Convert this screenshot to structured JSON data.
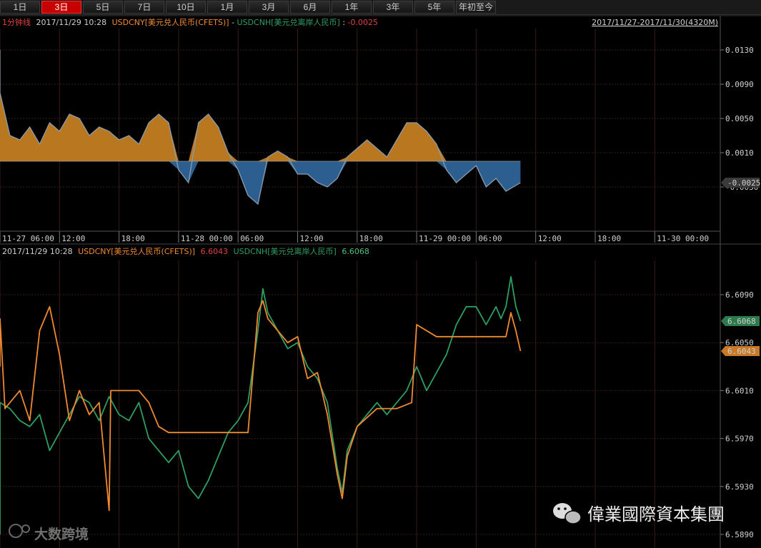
{
  "tabs": [
    {
      "label": "1日",
      "active": false
    },
    {
      "label": "3日",
      "active": true
    },
    {
      "label": "5日",
      "active": false
    },
    {
      "label": "7日",
      "active": false
    },
    {
      "label": "10日",
      "active": false
    },
    {
      "label": "1月",
      "active": false
    },
    {
      "label": "3月",
      "active": false
    },
    {
      "label": "6月",
      "active": false
    },
    {
      "label": "1年",
      "active": false
    },
    {
      "label": "3年",
      "active": false
    },
    {
      "label": "5年",
      "active": false
    },
    {
      "label": "年初至今",
      "active": false
    }
  ],
  "top_panel": {
    "interval": "1分钟线",
    "datetime": "2017/11/29 10:28",
    "series_a": "USDCNY[美元兑人民币(CFETS)]",
    "separator": " - ",
    "series_b": "USDCNH[美元兑离岸人民币]",
    "value_sep": ": ",
    "value": "-0.0025",
    "range": "2017/11/27-2017/11/30(4320M)",
    "current_tag": "-0.0025",
    "y_ticks": [
      "0.0130",
      "0.0090",
      "0.0050",
      "0.0010",
      "-0.0030"
    ],
    "x_ticks": [
      "11-27 06:00",
      "12:00",
      "18:00",
      "11-28 00:00",
      "06:00",
      "12:00",
      "18:00",
      "11-29 00:00",
      "06:00",
      "12:00",
      "18:00",
      "11-30 00:00"
    ]
  },
  "bottom_panel": {
    "datetime": "2017/11/29 10:28",
    "series_a": "USDCNY[美元兑人民币(CFETS)]",
    "value_a": "6.6043",
    "series_b": "USDCNH[美元兑离岸人民币]",
    "value_b": "6.6068",
    "tag_b": "6.6068",
    "tag_a": "6.6043",
    "y_ticks": [
      "6.6090",
      "6.6050",
      "6.6010",
      "6.5970",
      "6.5930",
      "6.5890"
    ]
  },
  "watermark": {
    "left": "大数跨境",
    "right": "偉業國際資本集團"
  },
  "colors": {
    "cny": "#f08a30",
    "cnh": "#2e9e62",
    "spread_pos": "#b9781f",
    "spread_neg": "#2c5f8f",
    "active_tab": "#c80000"
  },
  "chart_data": [
    {
      "type": "area",
      "ylim": [
        -0.0055,
        0.0155
      ],
      "x_start": "2017-11-27 03:00",
      "x_end": "2017-11-30 03:00",
      "series": [
        {
          "name": "USDCNY[美元兑人民币(CFETS)] - USDCNH[美元兑离岸人民币]",
          "points": [
            [
              "2017-11-27 03:00",
              0.013
            ],
            [
              "2017-11-27 04:00",
              0.0125
            ],
            [
              "2017-11-27 05:00",
              0.011
            ],
            [
              "2017-11-27 06:00",
              0.008
            ],
            [
              "2017-11-27 07:00",
              0.003
            ],
            [
              "2017-11-27 08:00",
              0.0025
            ],
            [
              "2017-11-27 09:00",
              0.004
            ],
            [
              "2017-11-27 10:00",
              0.002
            ],
            [
              "2017-11-27 11:00",
              0.0045
            ],
            [
              "2017-11-27 12:00",
              0.0035
            ],
            [
              "2017-11-27 13:00",
              0.0055
            ],
            [
              "2017-11-27 14:00",
              0.005
            ],
            [
              "2017-11-27 15:00",
              0.003
            ],
            [
              "2017-11-27 16:00",
              0.004
            ],
            [
              "2017-11-27 17:00",
              0.0035
            ],
            [
              "2017-11-27 18:00",
              0.0025
            ],
            [
              "2017-11-27 19:00",
              0.003
            ],
            [
              "2017-11-27 20:00",
              0.002
            ],
            [
              "2017-11-27 21:00",
              0.0045
            ],
            [
              "2017-11-27 22:00",
              0.0055
            ],
            [
              "2017-11-27 23:00",
              0.0045
            ],
            [
              "2017-11-28 00:00",
              -0.001
            ],
            [
              "2017-11-28 01:00",
              -0.0025
            ],
            [
              "2017-11-28 02:00",
              0.0045
            ],
            [
              "2017-11-28 03:00",
              0.0055
            ],
            [
              "2017-11-28 04:00",
              0.004
            ],
            [
              "2017-11-28 05:00",
              0.001
            ],
            [
              "2017-11-28 06:00",
              -0.001
            ],
            [
              "2017-11-28 07:00",
              -0.004
            ],
            [
              "2017-11-28 08:00",
              -0.005
            ],
            [
              "2017-11-28 09:00",
              0.0005
            ],
            [
              "2017-11-28 10:00",
              0.0012
            ],
            [
              "2017-11-28 11:00",
              0.0005
            ],
            [
              "2017-11-28 12:00",
              -0.0015
            ],
            [
              "2017-11-28 13:00",
              -0.0015
            ],
            [
              "2017-11-28 14:00",
              -0.0025
            ],
            [
              "2017-11-28 15:00",
              -0.003
            ],
            [
              "2017-11-28 16:00",
              -0.002
            ],
            [
              "2017-11-28 17:00",
              0.0005
            ],
            [
              "2017-11-28 18:00",
              0.0015
            ],
            [
              "2017-11-28 19:00",
              0.0025
            ],
            [
              "2017-11-28 20:00",
              0.0015
            ],
            [
              "2017-11-28 21:00",
              0.0005
            ],
            [
              "2017-11-28 22:00",
              0.0025
            ],
            [
              "2017-11-28 23:00",
              0.0045
            ],
            [
              "2017-11-29 00:00",
              0.0045
            ],
            [
              "2017-11-29 01:00",
              0.0035
            ],
            [
              "2017-11-29 02:00",
              0.002
            ],
            [
              "2017-11-29 03:00",
              -0.001
            ],
            [
              "2017-11-29 04:00",
              -0.0025
            ],
            [
              "2017-11-29 05:00",
              -0.0015
            ],
            [
              "2017-11-29 06:00",
              -0.0005
            ],
            [
              "2017-11-29 07:00",
              -0.003
            ],
            [
              "2017-11-29 08:00",
              -0.002
            ],
            [
              "2017-11-29 09:00",
              -0.0035
            ],
            [
              "2017-11-29 10:28",
              -0.0025
            ]
          ]
        }
      ]
    },
    {
      "type": "line",
      "ylim": [
        6.5885,
        6.612
      ],
      "x_start": "2017-11-27 03:00",
      "x_end": "2017-11-30 03:00",
      "series": [
        {
          "name": "USDCNY[美元兑人民币(CFETS)]",
          "points": [
            [
              "2017-11-27 03:00",
              6.603
            ],
            [
              "2017-11-27 05:00",
              6.603
            ],
            [
              "2017-11-27 05:30",
              6.607
            ],
            [
              "2017-11-27 06:30",
              6.5995
            ],
            [
              "2017-11-27 08:00",
              6.601
            ],
            [
              "2017-11-27 09:00",
              6.5985
            ],
            [
              "2017-11-27 10:00",
              6.606
            ],
            [
              "2017-11-27 11:00",
              6.608
            ],
            [
              "2017-11-27 12:00",
              6.604
            ],
            [
              "2017-11-27 13:00",
              6.5985
            ],
            [
              "2017-11-27 14:00",
              6.601
            ],
            [
              "2017-11-27 15:00",
              6.599
            ],
            [
              "2017-11-27 16:00",
              6.6
            ],
            [
              "2017-11-27 17:00",
              6.591
            ],
            [
              "2017-11-27 17:10",
              6.601
            ],
            [
              "2017-11-27 19:00",
              6.601
            ],
            [
              "2017-11-27 20:00",
              6.601
            ],
            [
              "2017-11-27 21:00",
              6.6
            ],
            [
              "2017-11-27 22:00",
              6.598
            ],
            [
              "2017-11-27 23:00",
              6.5975
            ],
            [
              "2017-11-28 06:00",
              6.5975
            ],
            [
              "2017-11-28 07:00",
              6.5975
            ],
            [
              "2017-11-28 08:00",
              6.6075
            ],
            [
              "2017-11-28 08:30",
              6.6085
            ],
            [
              "2017-11-28 09:00",
              6.607
            ],
            [
              "2017-11-28 10:00",
              6.606
            ],
            [
              "2017-11-28 11:00",
              6.605
            ],
            [
              "2017-11-28 12:00",
              6.6055
            ],
            [
              "2017-11-28 13:00",
              6.602
            ],
            [
              "2017-11-28 14:00",
              6.6025
            ],
            [
              "2017-11-28 15:00",
              6.599
            ],
            [
              "2017-11-28 16:00",
              6.594
            ],
            [
              "2017-11-28 16:30",
              6.592
            ],
            [
              "2017-11-28 17:00",
              6.5955
            ],
            [
              "2017-11-28 18:00",
              6.598
            ],
            [
              "2017-11-28 20:00",
              6.5995
            ],
            [
              "2017-11-28 22:00",
              6.5995
            ],
            [
              "2017-11-28 23:30",
              6.6
            ],
            [
              "2017-11-29 00:00",
              6.6065
            ],
            [
              "2017-11-29 02:00",
              6.6055
            ],
            [
              "2017-11-29 06:00",
              6.6055
            ],
            [
              "2017-11-29 09:00",
              6.6055
            ],
            [
              "2017-11-29 09:30",
              6.6075
            ],
            [
              "2017-11-29 10:00",
              6.606
            ],
            [
              "2017-11-29 10:28",
              6.6043
            ]
          ]
        },
        {
          "name": "USDCNH[美元兑离岸人民币]",
          "points": [
            [
              "2017-11-27 03:00",
              6.589
            ],
            [
              "2017-11-27 04:00",
              6.5905
            ],
            [
              "2017-11-27 05:00",
              6.595
            ],
            [
              "2017-11-27 06:00",
              6.6
            ],
            [
              "2017-11-27 07:00",
              6.5995
            ],
            [
              "2017-11-27 08:00",
              6.5985
            ],
            [
              "2017-11-27 09:00",
              6.598
            ],
            [
              "2017-11-27 10:00",
              6.599
            ],
            [
              "2017-11-27 11:00",
              6.596
            ],
            [
              "2017-11-27 12:00",
              6.5975
            ],
            [
              "2017-11-27 13:00",
              6.599
            ],
            [
              "2017-11-27 14:00",
              6.6005
            ],
            [
              "2017-11-27 15:00",
              6.6
            ],
            [
              "2017-11-27 16:00",
              6.5985
            ],
            [
              "2017-11-27 17:00",
              6.6005
            ],
            [
              "2017-11-27 18:00",
              6.599
            ],
            [
              "2017-11-27 19:00",
              6.5985
            ],
            [
              "2017-11-27 20:00",
              6.6
            ],
            [
              "2017-11-27 21:00",
              6.597
            ],
            [
              "2017-11-27 22:00",
              6.596
            ],
            [
              "2017-11-27 23:00",
              6.595
            ],
            [
              "2017-11-28 00:00",
              6.596
            ],
            [
              "2017-11-28 01:00",
              6.593
            ],
            [
              "2017-11-28 02:00",
              6.592
            ],
            [
              "2017-11-28 03:00",
              6.5935
            ],
            [
              "2017-11-28 04:00",
              6.5955
            ],
            [
              "2017-11-28 05:00",
              6.5975
            ],
            [
              "2017-11-28 06:00",
              6.5985
            ],
            [
              "2017-11-28 07:00",
              6.6
            ],
            [
              "2017-11-28 08:00",
              6.606
            ],
            [
              "2017-11-28 08:30",
              6.6095
            ],
            [
              "2017-11-28 09:00",
              6.6075
            ],
            [
              "2017-11-28 10:00",
              6.606
            ],
            [
              "2017-11-28 11:00",
              6.6045
            ],
            [
              "2017-11-28 12:00",
              6.605
            ],
            [
              "2017-11-28 13:00",
              6.603
            ],
            [
              "2017-11-28 14:00",
              6.602
            ],
            [
              "2017-11-28 15:00",
              6.6
            ],
            [
              "2017-11-28 16:00",
              6.5945
            ],
            [
              "2017-11-28 16:30",
              6.5925
            ],
            [
              "2017-11-28 17:00",
              6.596
            ],
            [
              "2017-11-28 18:00",
              6.598
            ],
            [
              "2017-11-28 19:00",
              6.599
            ],
            [
              "2017-11-28 20:00",
              6.6
            ],
            [
              "2017-11-28 21:00",
              6.599
            ],
            [
              "2017-11-28 22:00",
              6.6
            ],
            [
              "2017-11-28 23:00",
              6.601
            ],
            [
              "2017-11-29 00:00",
              6.603
            ],
            [
              "2017-11-29 01:00",
              6.601
            ],
            [
              "2017-11-29 02:00",
              6.6025
            ],
            [
              "2017-11-29 03:00",
              6.604
            ],
            [
              "2017-11-29 04:00",
              6.6065
            ],
            [
              "2017-11-29 05:00",
              6.608
            ],
            [
              "2017-11-29 06:00",
              6.608
            ],
            [
              "2017-11-29 07:00",
              6.6065
            ],
            [
              "2017-11-29 08:00",
              6.608
            ],
            [
              "2017-11-29 08:30",
              6.607
            ],
            [
              "2017-11-29 09:00",
              6.608
            ],
            [
              "2017-11-29 09:30",
              6.6105
            ],
            [
              "2017-11-29 10:00",
              6.608
            ],
            [
              "2017-11-29 10:28",
              6.6068
            ]
          ]
        }
      ]
    }
  ]
}
